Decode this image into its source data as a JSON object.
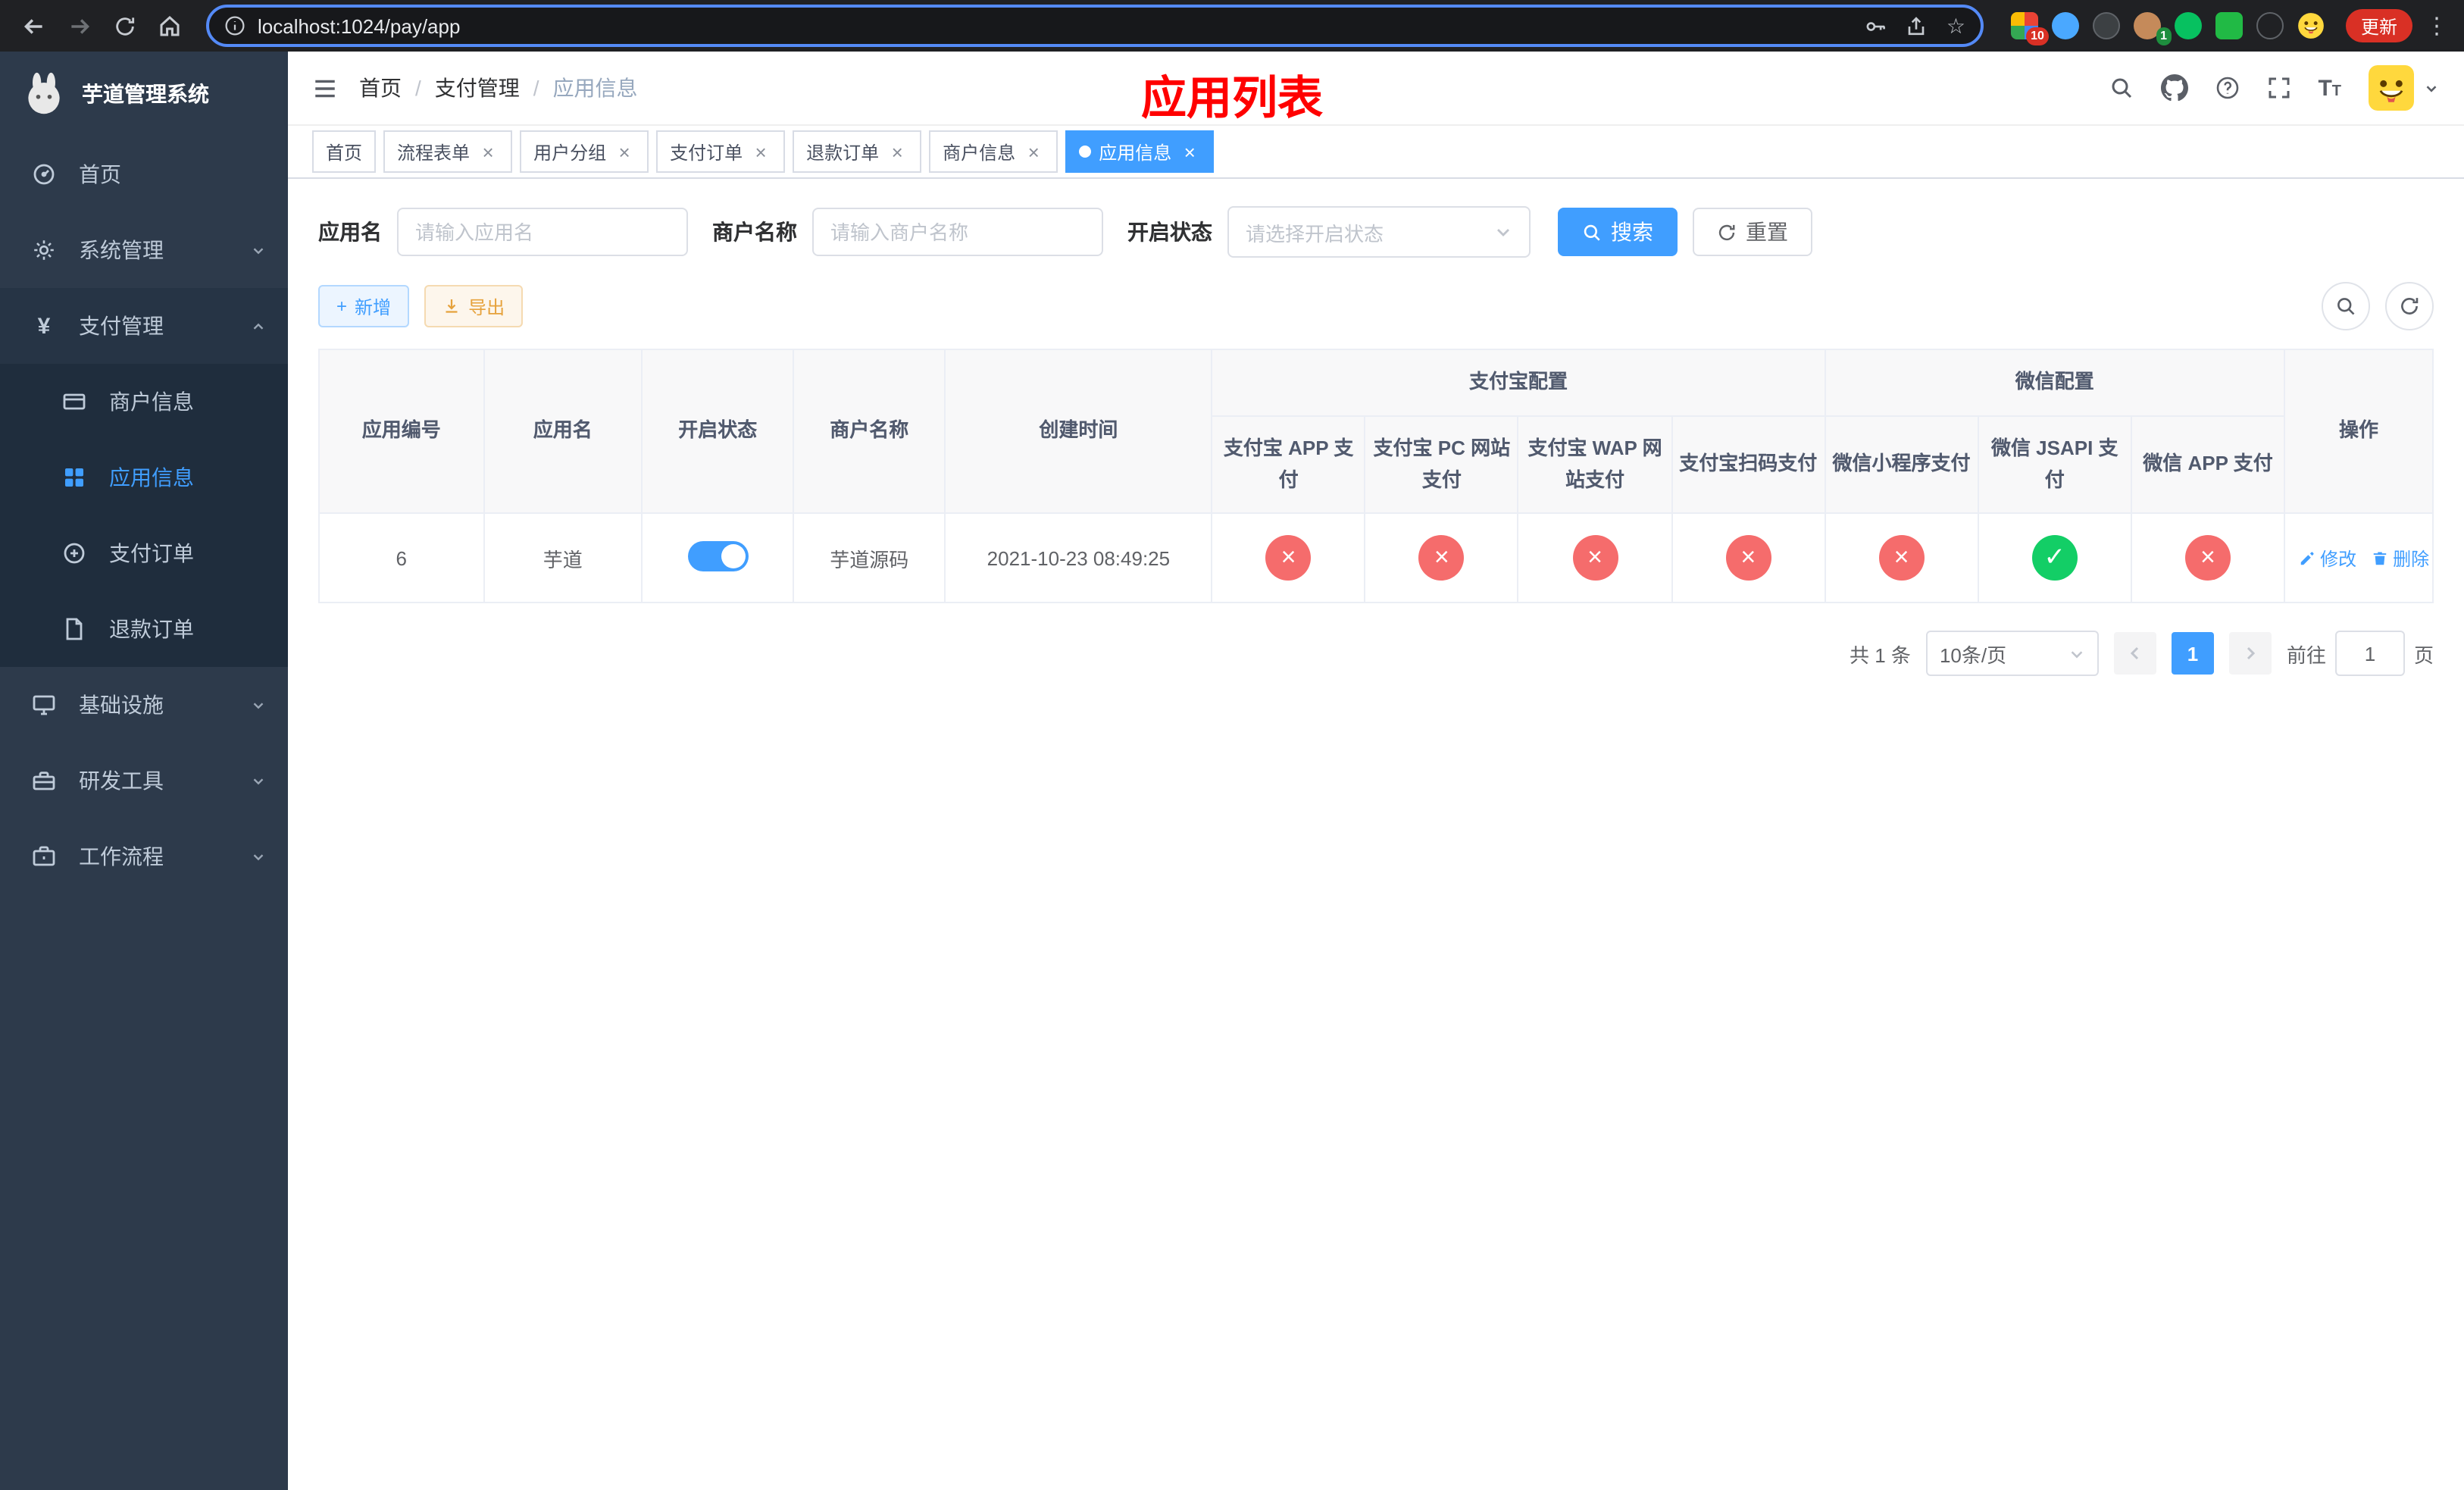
{
  "browser": {
    "url": "localhost:1024/pay/app",
    "update_button": "更新",
    "extension_badge_a": "10",
    "extension_badge_b": "1"
  },
  "sidebar": {
    "app_title": "芋道管理系统",
    "menu": [
      {
        "label": "首页"
      },
      {
        "label": "系统管理"
      },
      {
        "label": "支付管理"
      },
      {
        "label": "基础设施"
      },
      {
        "label": "研发工具"
      },
      {
        "label": "工作流程"
      }
    ],
    "payment_submenu": [
      {
        "label": "商户信息"
      },
      {
        "label": "应用信息"
      },
      {
        "label": "支付订单"
      },
      {
        "label": "退款订单"
      }
    ]
  },
  "navbar": {
    "breadcrumb": [
      "首页",
      "支付管理",
      "应用信息"
    ],
    "breadcrumb_separator": "/",
    "overlay_title": "应用列表"
  },
  "tabs": [
    {
      "label": "首页"
    },
    {
      "label": "流程表单"
    },
    {
      "label": "用户分组"
    },
    {
      "label": "支付订单"
    },
    {
      "label": "退款订单"
    },
    {
      "label": "商户信息"
    },
    {
      "label": "应用信息"
    }
  ],
  "filters": {
    "app_name_label": "应用名",
    "app_name_placeholder": "请输入应用名",
    "merchant_label": "商户名称",
    "merchant_placeholder": "请输入商户名称",
    "status_label": "开启状态",
    "status_placeholder": "请选择开启状态",
    "search_button": "搜索",
    "reset_button": "重置"
  },
  "toolbar": {
    "add_button": "新增",
    "export_button": "导出"
  },
  "table": {
    "group_headers": {
      "alipay": "支付宝配置",
      "wechat": "微信配置"
    },
    "columns": {
      "app_id": "应用编号",
      "app_name": "应用名",
      "status": "开启状态",
      "merchant_name": "商户名称",
      "create_time": "创建时间",
      "alipay_app": "支付宝 APP 支付",
      "alipay_pc": "支付宝 PC 网站支付",
      "alipay_wap": "支付宝 WAP 网站支付",
      "alipay_qr": "支付宝扫码支付",
      "wx_lite": "微信小程序支付",
      "wx_jsapi": "微信 JSAPI 支付",
      "wx_app": "微信 APP 支付",
      "actions": "操作"
    },
    "rows": [
      {
        "app_id": "6",
        "app_name": "芋道",
        "status_on": true,
        "merchant_name": "芋道源码",
        "create_time": "2021-10-23 08:49:25",
        "channels": [
          "no",
          "no",
          "no",
          "no",
          "no",
          "yes",
          "no"
        ],
        "edit_label": "修改",
        "delete_label": "删除"
      }
    ]
  },
  "pagination": {
    "total_text": "共 1 条",
    "page_size": "10条/页",
    "current_page": "1",
    "goto_prefix": "前往",
    "goto_value": "1",
    "goto_suffix": "页"
  },
  "icons": {
    "star-icon": "☆",
    "menu-dots-icon": "⋮",
    "yen-icon": "¥",
    "plus-icon": "+",
    "check-icon": "✓",
    "cross-icon": "×"
  },
  "colors": {
    "primary": "#409eff",
    "success": "#13ce66",
    "danger": "#f56c6c",
    "warning": "#e6a23c",
    "overlay_title_red": "#ff0000"
  }
}
